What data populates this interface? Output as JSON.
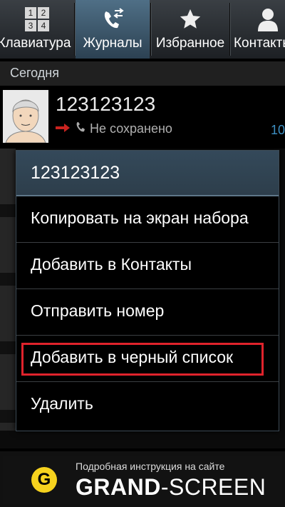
{
  "tabs": [
    {
      "label": "Клавиатура",
      "icon": "keypad-icon",
      "active": false
    },
    {
      "label": "Журналы",
      "icon": "call-log-icon",
      "active": true
    },
    {
      "label": "Избранное",
      "icon": "star-icon",
      "active": false
    },
    {
      "label": "Контакты",
      "icon": "contact-person-icon",
      "active": false
    }
  ],
  "keypad_digits": [
    "1",
    "2",
    "3",
    "4"
  ],
  "section_header": "Сегодня",
  "log_entry": {
    "number": "123123123",
    "status": "Не сохранено",
    "time_fragment": "10"
  },
  "dialog": {
    "title": "123123123",
    "items": [
      "Копировать на экран набора",
      "Добавить в Контакты",
      "Отправить номер",
      "Добавить в черный список",
      "Удалить"
    ],
    "highlighted_item": "Добавить в черный список"
  },
  "banner": {
    "logo_letter": "G",
    "subtitle": "Подробная инструкция на сайте",
    "brand_bold": "GRAND",
    "brand_rest": "-SCREEN"
  },
  "colors": {
    "accent_blue": "#3d8fc2",
    "highlight_red": "#e0232c",
    "logo_yellow": "#f6d21e"
  }
}
